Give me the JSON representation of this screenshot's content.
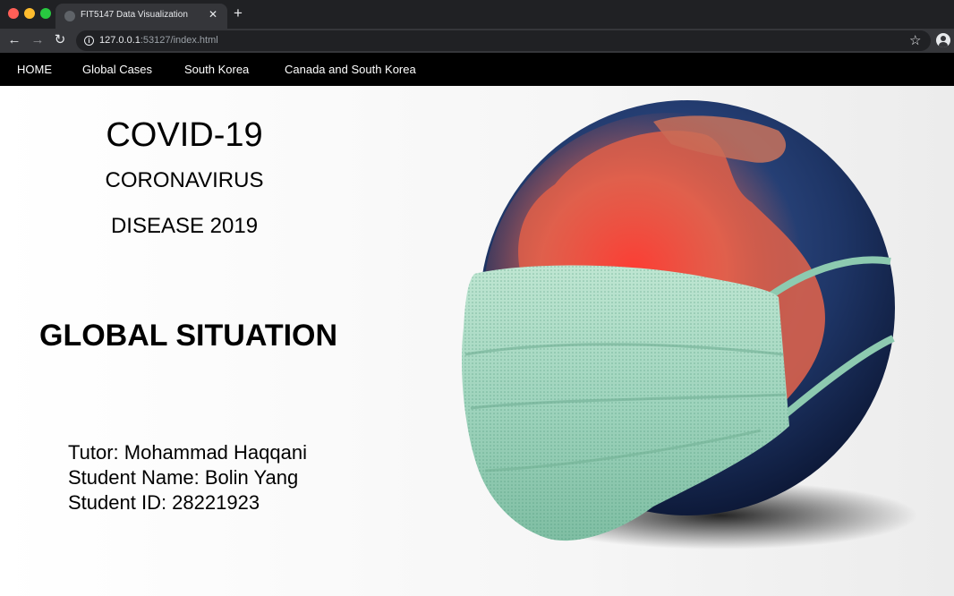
{
  "browser": {
    "tab_title": "FIT5147 Data Visualization",
    "url_host": "127.0.0.1",
    "url_rest": ":53127/index.html",
    "icons": [
      "back-icon",
      "forward-icon",
      "reload-icon",
      "info-icon",
      "star-icon",
      "profile-icon",
      "close-icon",
      "new-tab-icon"
    ]
  },
  "nav": {
    "items": [
      {
        "label": "HOME"
      },
      {
        "label": "Global Cases"
      },
      {
        "label": "South Korea"
      },
      {
        "label": "Canada and South Korea"
      }
    ]
  },
  "hero": {
    "title": "COVID-19",
    "subtitle_1": "CORONAVIRUS",
    "subtitle_2": "DISEASE 2019",
    "heading": "GLOBAL SITUATION"
  },
  "credits": {
    "tutor": "Tutor: Mohammad Haqqani",
    "student_name": "Student Name: Bolin Yang",
    "student_id": "Student ID: 28221923"
  },
  "colors": {
    "nav_bg": "#000000",
    "mask": "#9fd4bd",
    "globe_ocean": "#1e3566",
    "globe_land": "#e85a45"
  }
}
